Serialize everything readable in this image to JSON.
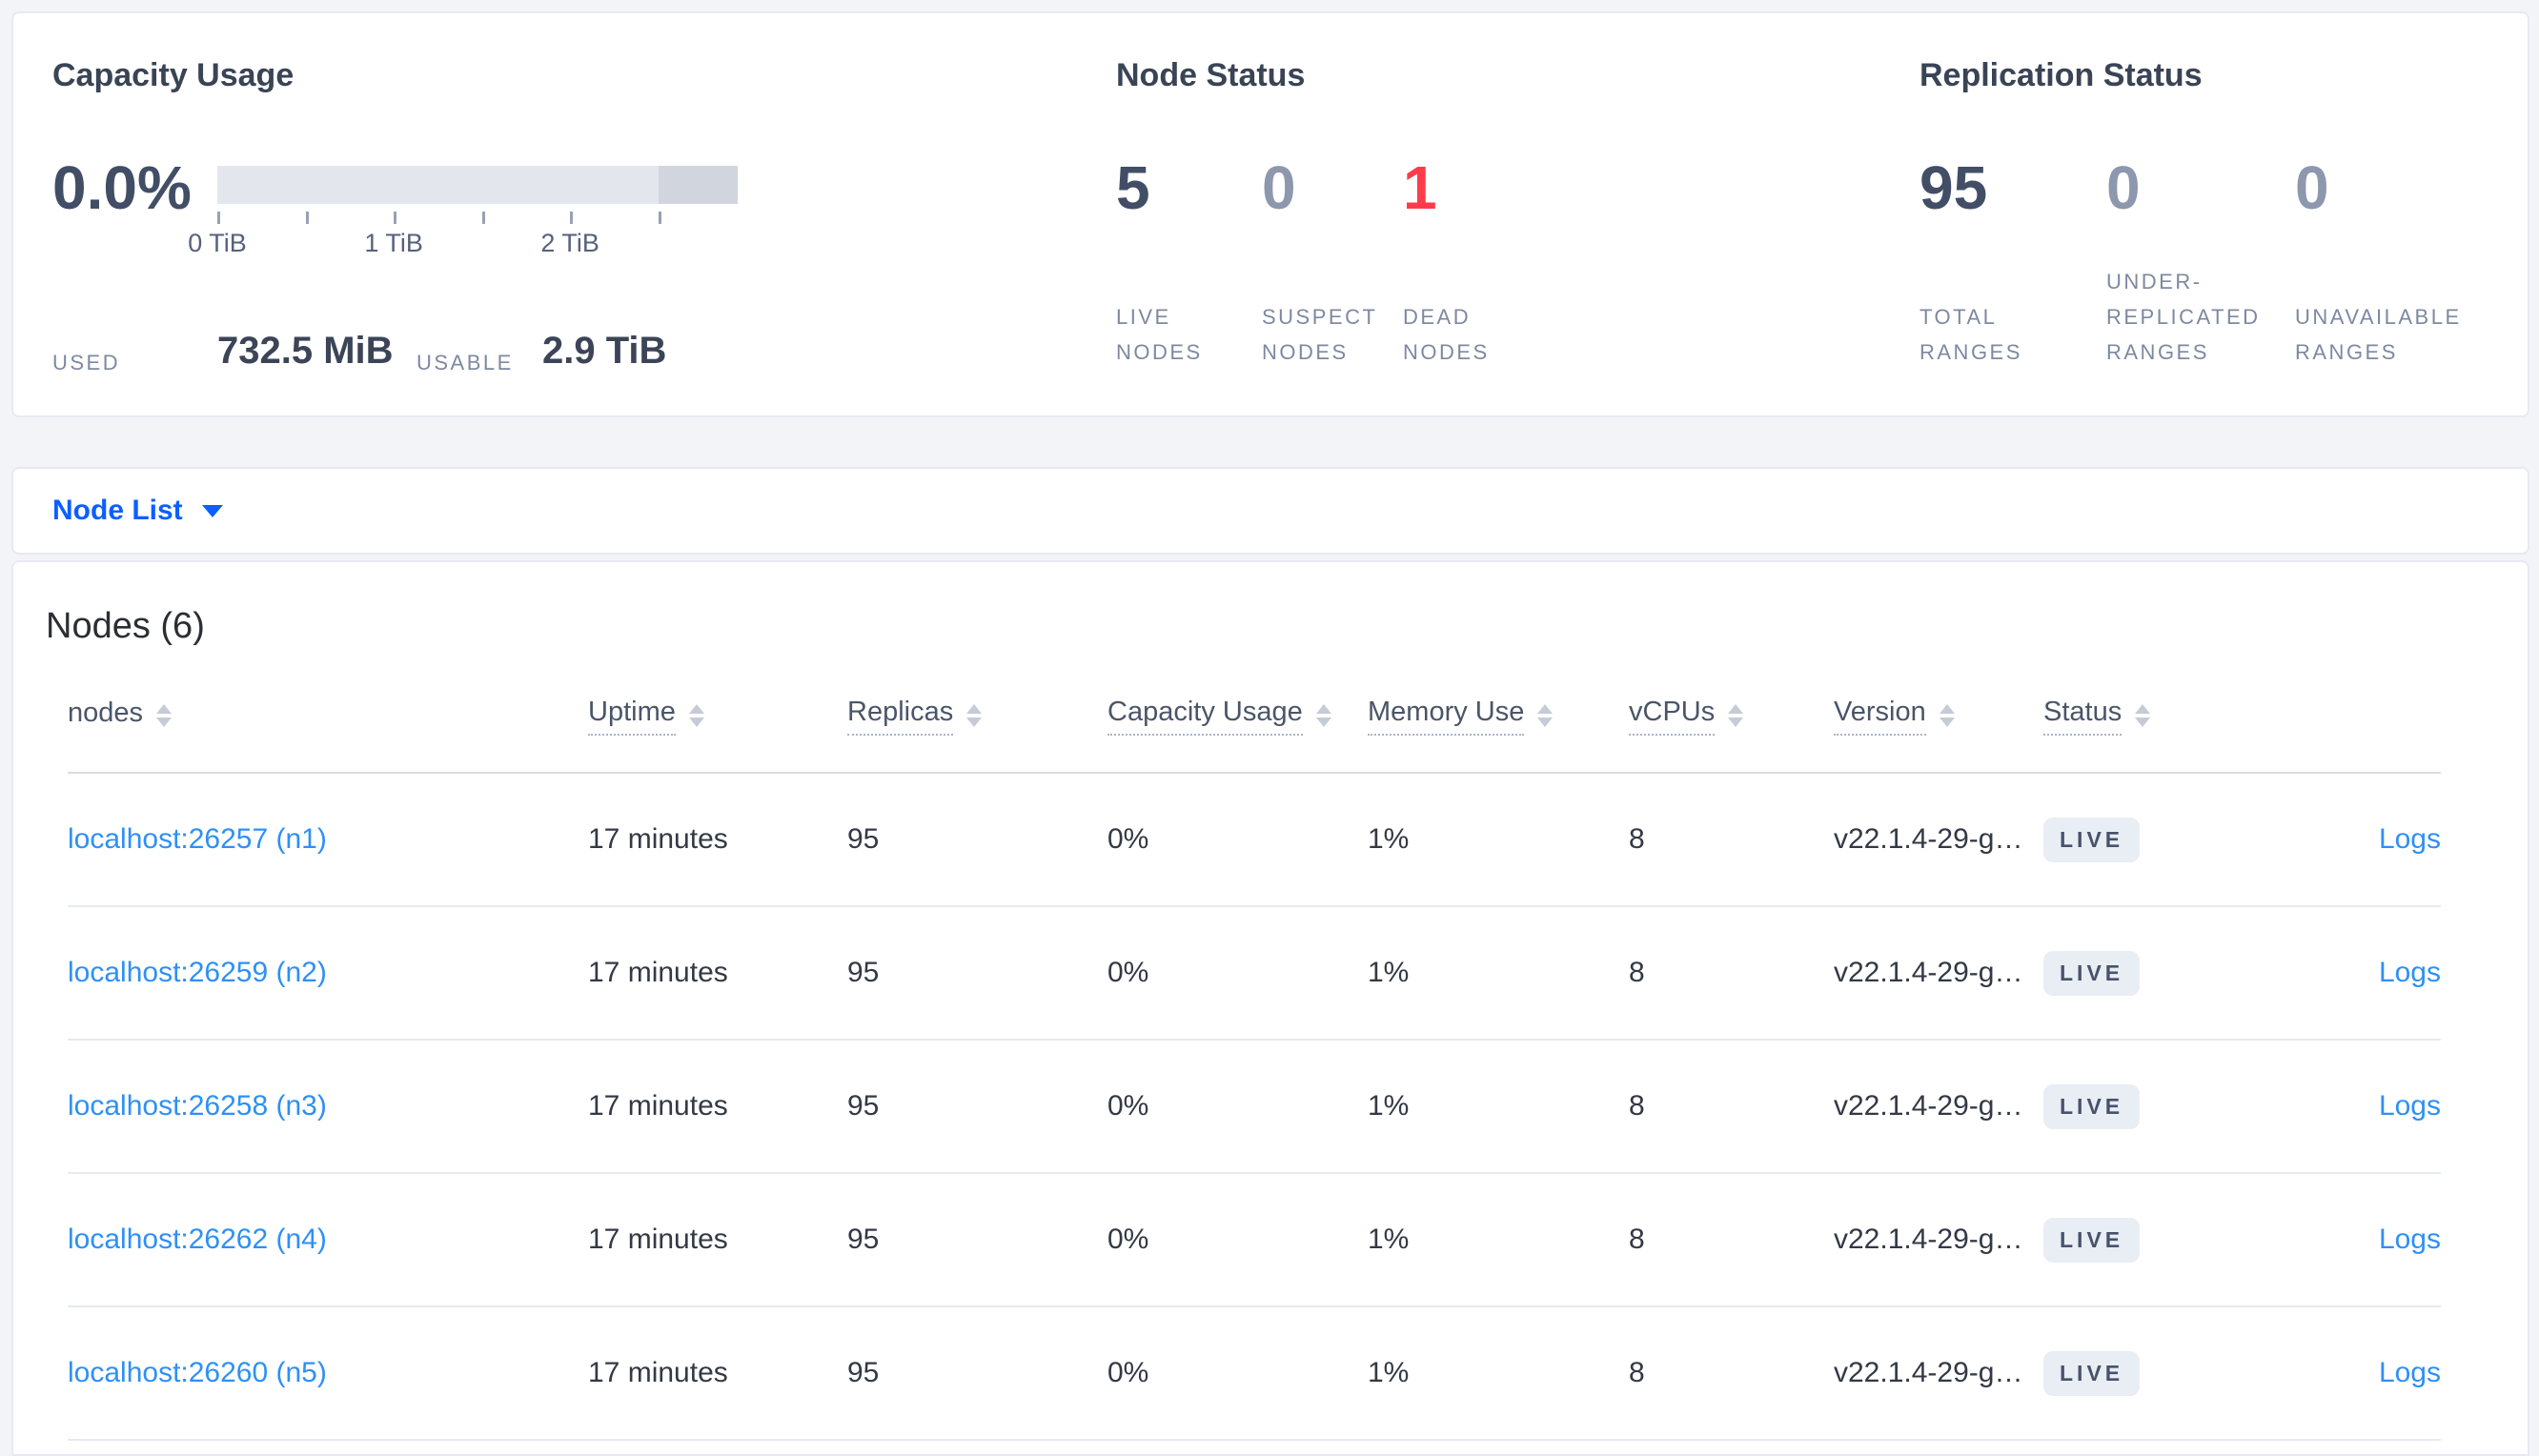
{
  "colors": {
    "page_background": "#f2f4f8",
    "accent_blue": "#0b5fff",
    "link_blue": "#2e90f6",
    "dead_red": "#ff3b4b",
    "dark_stat": "#414e66",
    "muted_stat": "#8d97ad"
  },
  "summary_cards": {
    "capacity": {
      "title": "Capacity Usage",
      "percent": "0.0%",
      "bar": {
        "max_tib": 2.95,
        "dark_from_tib": 2.5,
        "ticks": [
          {
            "pos": 0,
            "label": "0 TiB"
          },
          {
            "pos": 0.5,
            "label": ""
          },
          {
            "pos": 1,
            "label": "1 TiB"
          },
          {
            "pos": 1.5,
            "label": ""
          },
          {
            "pos": 2,
            "label": "2 TiB"
          },
          {
            "pos": 2.5,
            "label": ""
          }
        ]
      },
      "used_label": "USED",
      "used_value": "732.5 MiB",
      "usable_label": "USABLE",
      "usable_value": "2.9 TiB"
    },
    "node_status": {
      "title": "Node Status",
      "stats": [
        {
          "value": "5",
          "label": "LIVE NODES",
          "color": "#414e66"
        },
        {
          "value": "0",
          "label": "SUSPECT NODES",
          "color": "#8d97ad"
        },
        {
          "value": "1",
          "label": "DEAD NODES",
          "color": "#ff3b4b"
        }
      ]
    },
    "replication_status": {
      "title": "Replication Status",
      "stats": [
        {
          "value": "95",
          "label": "TOTAL RANGES",
          "color": "#414e66"
        },
        {
          "value": "0",
          "label": "UNDER-REPLICATED RANGES",
          "color": "#8d97ad"
        },
        {
          "value": "0",
          "label": "UNAVAILABLE RANGES",
          "color": "#8d97ad"
        }
      ]
    }
  },
  "view_selector": {
    "label": "Node List",
    "caret_icon": "chevron-down-icon"
  },
  "nodes_table": {
    "title": "Nodes (6)",
    "columns": [
      {
        "label": "nodes",
        "underlined": false
      },
      {
        "label": "Uptime",
        "underlined": true
      },
      {
        "label": "Replicas",
        "underlined": true
      },
      {
        "label": "Capacity Usage",
        "underlined": true
      },
      {
        "label": "Memory Use",
        "underlined": true
      },
      {
        "label": "vCPUs",
        "underlined": true
      },
      {
        "label": "Version",
        "underlined": true
      },
      {
        "label": "Status",
        "underlined": true
      }
    ],
    "rows": [
      {
        "node": "localhost:26257 (n1)",
        "uptime": "17 minutes",
        "replicas": "95",
        "capacity_usage": "0%",
        "memory_use": "1%",
        "vcpus": "8",
        "version": "v22.1.4-29-g…",
        "status": "LIVE",
        "logs": "Logs"
      },
      {
        "node": "localhost:26259 (n2)",
        "uptime": "17 minutes",
        "replicas": "95",
        "capacity_usage": "0%",
        "memory_use": "1%",
        "vcpus": "8",
        "version": "v22.1.4-29-g…",
        "status": "LIVE",
        "logs": "Logs"
      },
      {
        "node": "localhost:26258 (n3)",
        "uptime": "17 minutes",
        "replicas": "95",
        "capacity_usage": "0%",
        "memory_use": "1%",
        "vcpus": "8",
        "version": "v22.1.4-29-g…",
        "status": "LIVE",
        "logs": "Logs"
      },
      {
        "node": "localhost:26262 (n4)",
        "uptime": "17 minutes",
        "replicas": "95",
        "capacity_usage": "0%",
        "memory_use": "1%",
        "vcpus": "8",
        "version": "v22.1.4-29-g…",
        "status": "LIVE",
        "logs": "Logs"
      },
      {
        "node": "localhost:26260 (n5)",
        "uptime": "17 minutes",
        "replicas": "95",
        "capacity_usage": "0%",
        "memory_use": "1%",
        "vcpus": "8",
        "version": "v22.1.4-29-g…",
        "status": "LIVE",
        "logs": "Logs"
      }
    ]
  }
}
